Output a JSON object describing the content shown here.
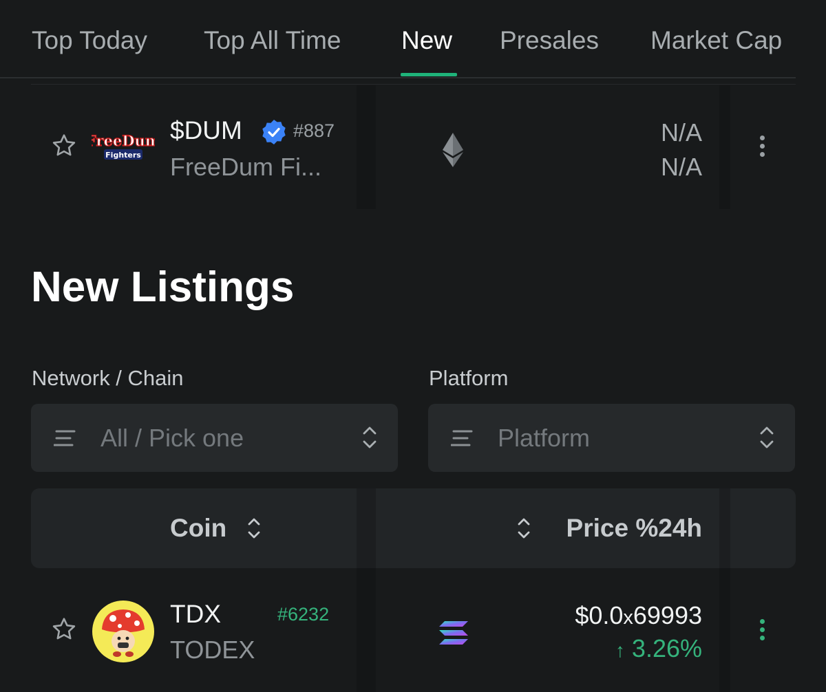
{
  "tabs": [
    {
      "label": "Top Today"
    },
    {
      "label": "Top All Time"
    },
    {
      "label": "New",
      "active": true
    },
    {
      "label": "Presales"
    },
    {
      "label": "Market Cap"
    }
  ],
  "promoted_row": {
    "logo_text_line1": "FreeDum",
    "logo_text_line2": "Fighters",
    "symbol": "$DUM",
    "verified": true,
    "rank": "#887",
    "name": "FreeDum Fi...",
    "chain_icon": "ethereum-icon",
    "price": "N/A",
    "change": "N/A"
  },
  "section": {
    "title": "New Listings"
  },
  "filters": {
    "network_label": "Network / Chain",
    "network_placeholder": "All / Pick one",
    "platform_label": "Platform",
    "platform_placeholder": "Platform"
  },
  "table": {
    "col_coin": "Coin",
    "col_price": "Price %24h"
  },
  "listing_row": {
    "symbol": "TDX",
    "rank": "#6232",
    "name": "TODEX",
    "chain_icon": "solana-icon",
    "price_prefix": "$0.0",
    "price_sub": "x",
    "price_digits": "69993",
    "change_arrow": "↑",
    "change": "3.26%"
  },
  "colors": {
    "accent": "#1fb37a",
    "positive": "#35b37c",
    "background": "#181a1b"
  }
}
